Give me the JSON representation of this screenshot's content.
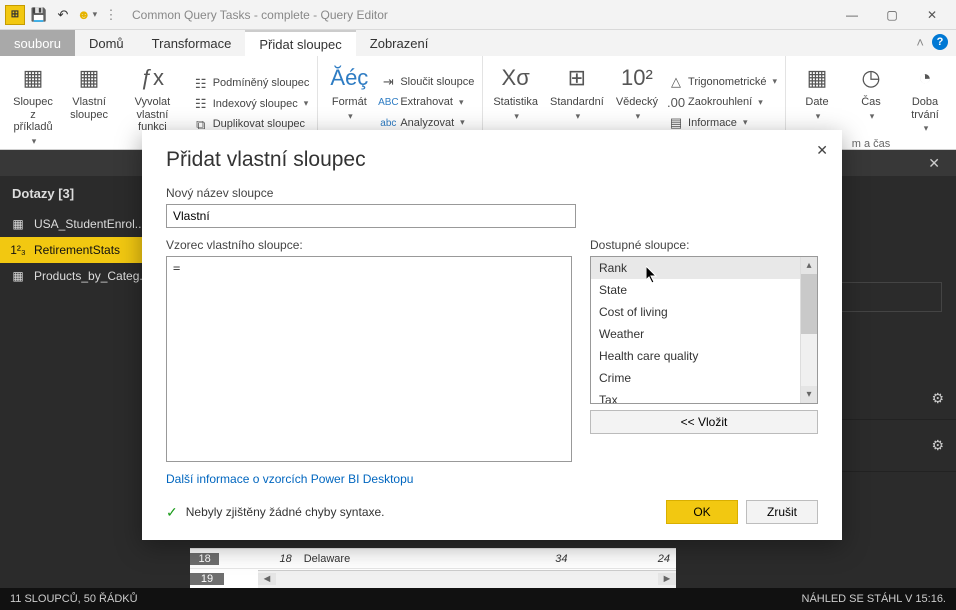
{
  "titlebar": {
    "title": "Common Query Tasks - complete - Query Editor"
  },
  "tabs": {
    "file": "souboru",
    "items": [
      "Domů",
      "Transformace",
      "Přidat sloupec",
      "Zobrazení"
    ],
    "active": 2
  },
  "ribbon": {
    "g1": {
      "btn1": "Sloupec z\npříkladů",
      "btn2": "Vlastní\nsloupec",
      "btn3": "Vyvolat\nvlastní funkci",
      "cond": "Podmíněný sloupec",
      "index": "Indexový sloupec",
      "dup": "Duplikovat sloupec"
    },
    "g2": {
      "format": "Formát",
      "merge": "Sloučit sloupce",
      "extract": "Extrahovat",
      "parse": "Analyzovat"
    },
    "g3": {
      "stat": "Statistika",
      "std": "Standardní",
      "sci": "Vědecký",
      "trig": "Trigonometrické",
      "round": "Zaokrouhlení",
      "info": "Informace"
    },
    "g4": {
      "date": "Date",
      "time": "Čas",
      "dur": "Doba\ntrvání",
      "cap": "m a čas"
    }
  },
  "queries": {
    "header": "Dotazy [3]",
    "items": [
      {
        "icon": "table-icon",
        "label": "USA_StudentEnrol..."
      },
      {
        "icon": "number-icon",
        "label": "RetirementStats"
      },
      {
        "icon": "table-icon",
        "label": "Products_by_Categ..."
      }
    ],
    "selected": 1
  },
  "grid_rows": [
    {
      "n": "18",
      "rank": "18",
      "state": "Delaware",
      "v3": "34",
      "v4": "24"
    },
    {
      "n": "19",
      "rank": "",
      "state": "",
      "v3": "",
      "v4": ""
    }
  ],
  "dialog": {
    "title": "Přidat vlastní sloupec",
    "name_label": "Nový název sloupce",
    "name_value": "Vlastní",
    "formula_label": "Vzorec vlastního sloupce:",
    "formula_value": "=",
    "avail_label": "Dostupné sloupce:",
    "columns": [
      "Rank",
      "State",
      "Cost of living",
      "Weather",
      "Health care quality",
      "Crime",
      "Tax"
    ],
    "selected_col": 0,
    "insert": "<< Vložit",
    "link": "Další informace o vzorcích Power BI Desktopu",
    "syntax": "Nebyly zjištěny žádné chyby syntaxe.",
    "ok": "OK",
    "cancel": "Zrušit"
  },
  "status": {
    "left": "11 SLOUPCŮ, 50 ŘÁDKŮ",
    "right": "NÁHLED SE STÁHL V 15:16."
  }
}
